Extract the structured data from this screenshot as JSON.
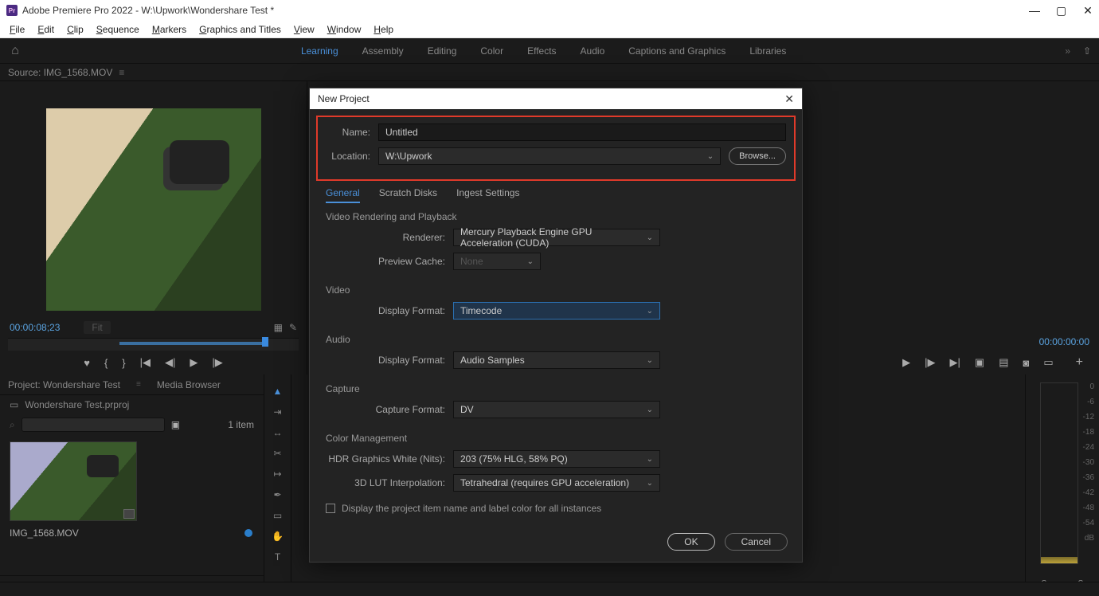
{
  "titlebar": {
    "title": "Adobe Premiere Pro 2022 - W:\\Upwork\\Wondershare Test *"
  },
  "menubar": [
    "File",
    "Edit",
    "Clip",
    "Sequence",
    "Markers",
    "Graphics and Titles",
    "View",
    "Window",
    "Help"
  ],
  "workspace": {
    "tabs": [
      "Learning",
      "Assembly",
      "Editing",
      "Color",
      "Effects",
      "Audio",
      "Captions and Graphics",
      "Libraries"
    ],
    "active": "Learning"
  },
  "source": {
    "label": "Source: IMG_1568.MOV",
    "timecode": "00:00:08;23",
    "fit": "Fit"
  },
  "program": {
    "timecode": "00:00:00:00"
  },
  "project": {
    "tabs": [
      "Project: Wondershare Test",
      "Media Browser"
    ],
    "file": "Wondershare Test.prproj",
    "itemcount": "1 item",
    "clipname": "IMG_1568.MOV"
  },
  "audiometers": {
    "ticks": [
      "0",
      "-6",
      "-12",
      "-18",
      "-24",
      "-30",
      "-36",
      "-42",
      "-48",
      "-54",
      "dB"
    ]
  },
  "dialog": {
    "title": "New Project",
    "name_label": "Name:",
    "name_value": "Untitled",
    "location_label": "Location:",
    "location_value": "W:\\Upwork",
    "browse": "Browse...",
    "tabs": [
      "General",
      "Scratch Disks",
      "Ingest Settings"
    ],
    "section_render": "Video Rendering and Playback",
    "renderer_label": "Renderer:",
    "renderer_value": "Mercury Playback Engine GPU Acceleration (CUDA)",
    "previewcache_label": "Preview Cache:",
    "previewcache_value": "None",
    "section_video": "Video",
    "video_df_label": "Display Format:",
    "video_df_value": "Timecode",
    "section_audio": "Audio",
    "audio_df_label": "Display Format:",
    "audio_df_value": "Audio Samples",
    "section_capture": "Capture",
    "capture_label": "Capture Format:",
    "capture_value": "DV",
    "section_color": "Color Management",
    "hdr_label": "HDR Graphics White (Nits):",
    "hdr_value": "203 (75% HLG, 58% PQ)",
    "lut_label": "3D LUT Interpolation:",
    "lut_value": "Tetrahedral (requires GPU acceleration)",
    "checkbox": "Display the project item name and label color for all instances",
    "ok": "OK",
    "cancel": "Cancel"
  }
}
